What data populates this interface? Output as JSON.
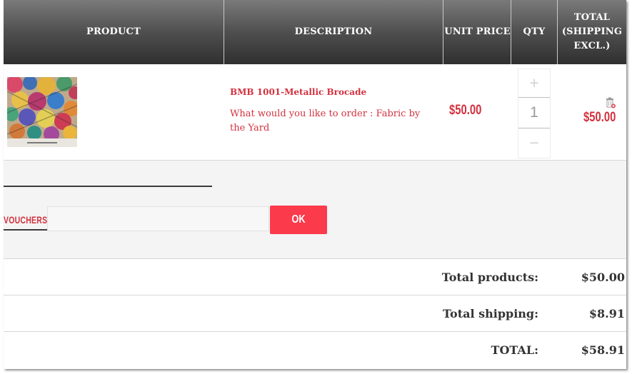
{
  "headers": {
    "product": "PRODUCT",
    "description": "DESCRIPTION",
    "unit_price": "UNIT PRICE",
    "qty": "QTY",
    "total_line1": "TOTAL",
    "total_line2": "(SHIPPING",
    "total_line3": "EXCL.)"
  },
  "item": {
    "name": "BMB 1001-Metallic Brocade",
    "option": "What would you like to order : Fabric by the Yard",
    "unit_price": "$50.00",
    "quantity": "1",
    "plus_symbol": "+",
    "minus_symbol": "−",
    "line_total": "$50.00",
    "delete_icon": "trash-icon"
  },
  "voucher": {
    "label": "VOUCHERS",
    "input_value": "",
    "button_label": "OK"
  },
  "summary": {
    "products_label": "Total products:",
    "products_value": "$50.00",
    "shipping_label": "Total shipping:",
    "shipping_value": "$8.91",
    "total_label": "TOTAL:",
    "total_value": "$58.91"
  },
  "colors": {
    "accent": "#d2313e",
    "button": "#fb3a4c",
    "header_dark": "#2f2f2f"
  }
}
